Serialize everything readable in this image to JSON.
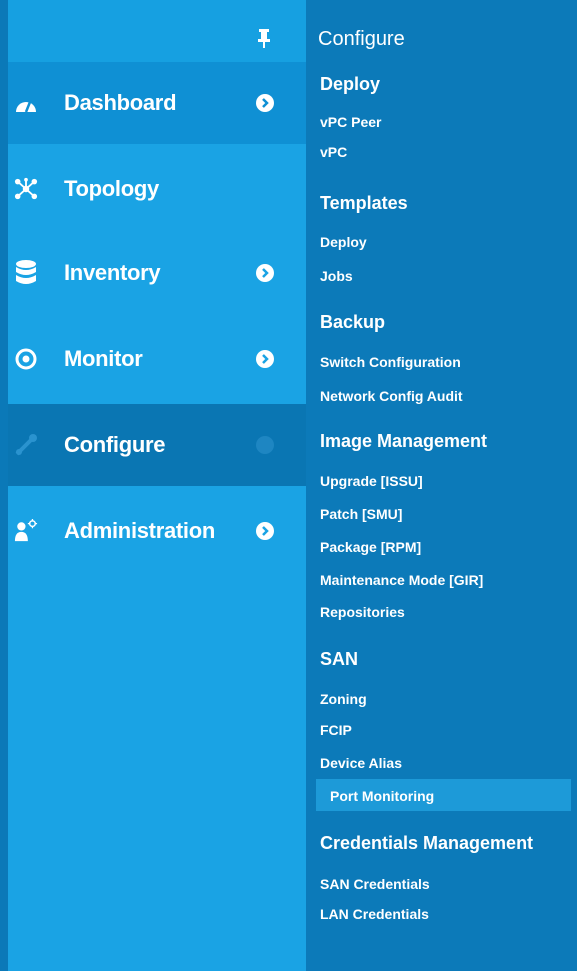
{
  "sidebar": {
    "items": [
      {
        "label": "Dashboard"
      },
      {
        "label": "Topology"
      },
      {
        "label": "Inventory"
      },
      {
        "label": "Monitor"
      },
      {
        "label": "Configure"
      },
      {
        "label": "Administration"
      }
    ]
  },
  "submenu": {
    "title": "Configure",
    "sections": {
      "deploy": {
        "title": "Deploy",
        "links": [
          "vPC Peer",
          "vPC"
        ]
      },
      "templates": {
        "title": "Templates",
        "links": [
          "Deploy",
          "Jobs"
        ]
      },
      "backup": {
        "title": "Backup",
        "links": [
          "Switch Configuration",
          "Network Config Audit"
        ]
      },
      "image": {
        "title": "Image Management",
        "links": [
          "Upgrade [ISSU]",
          "Patch [SMU]",
          "Package [RPM]",
          "Maintenance Mode [GIR]",
          "Repositories"
        ]
      },
      "san": {
        "title": "SAN",
        "links": [
          "Zoning",
          "FCIP",
          "Device Alias",
          "Port Monitoring"
        ]
      },
      "creds": {
        "title": "Credentials Management",
        "links": [
          "SAN Credentials",
          "LAN Credentials"
        ]
      }
    }
  },
  "colors": {
    "left_bg": "#1aa3e4",
    "active_bg": "#0e8acb",
    "submenu_bg": "#0c7ab9",
    "highlight": "#1d9ad8"
  }
}
